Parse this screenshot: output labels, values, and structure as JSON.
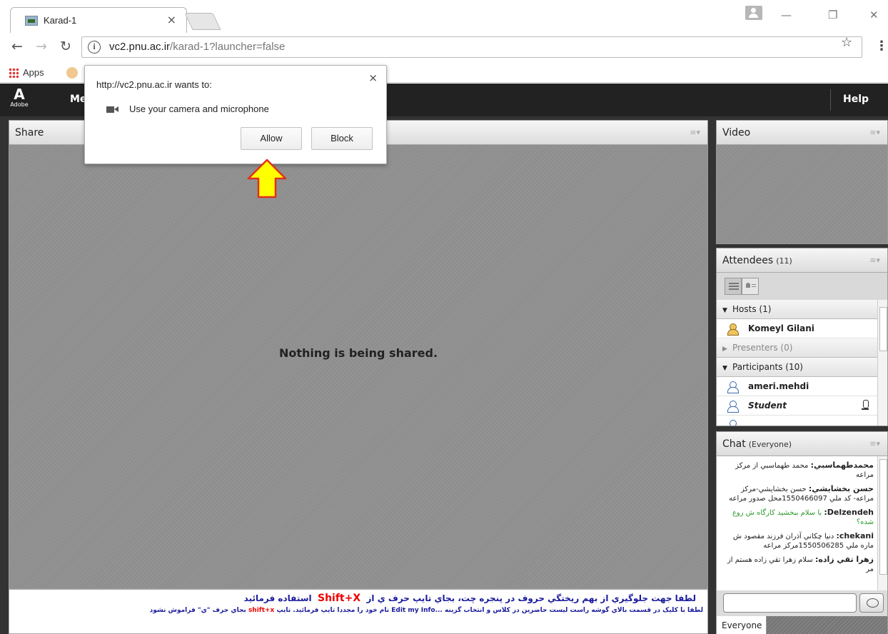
{
  "browser": {
    "tab_title": "Karad-1",
    "tab_close": "×",
    "url_domain": "vc2.pnu.ac.ir",
    "url_rest": "/karad-1?launcher=false",
    "bookmarks_apps": "Apps",
    "window_min": "—",
    "window_max": "❐",
    "window_close": "✕"
  },
  "popup": {
    "title": "http://vc2.pnu.ac.ir wants to:",
    "permission": "Use your camera and microphone",
    "allow": "Allow",
    "block": "Block",
    "close": "×"
  },
  "app": {
    "logo": "Adobe",
    "menu_fragment": "Me",
    "help": "Help"
  },
  "share": {
    "title": "Share",
    "message": "Nothing is being shared."
  },
  "video": {
    "title": "Video"
  },
  "attendees": {
    "title": "Attendees",
    "count": "(11)",
    "groups": {
      "hosts": "Hosts (1)",
      "presenters": "Presenters (0)",
      "participants": "Participants (10)"
    },
    "people": {
      "host1": "Komeyl Gilani",
      "p1": "ameri.mehdi",
      "p2": "Student"
    }
  },
  "chat": {
    "title": "Chat",
    "scope": "(Everyone)",
    "messages": [
      {
        "sender": "محمدطهماسبي:",
        "text": "محمد طهماسبي از مرکز مراعه"
      },
      {
        "sender": "حسن بخشايشي:",
        "text": "حسن بخشايشي-مرکز مراعه- کد ملي 1550466097محل صدور مراعه"
      },
      {
        "sender": "Delzendeh:",
        "text": "با سلام ببخشيد کارگاه ش روع شده؟"
      },
      {
        "sender": "chekani:",
        "text": "دنيا چکاني آذران فرزند مقصود ش ماره ملي 1550506285مرکز مراعه"
      },
      {
        "sender": "زهرا تقي زاده:",
        "text": "سلام زهرا تقي زاده هستم از مر"
      }
    ],
    "tab": "Everyone"
  },
  "notice": {
    "line1_pre": "لطفا جهت جلوگيري از بهم ريختگي حروف در پنجره چت، بجاي تايپ حرف ي از",
    "line1_key": "Shift+X",
    "line1_post": "استفاده فرمائيد",
    "line2_pre": "لطفا با کليک در قسمت بالاي گوشه راست ليست حاضرين در کلاس و انتخاب گزينه ...Edit my Info نام خود را مجددا تايپ فرمائيد. تايپ",
    "line2_key": "shift+x",
    "line2_post": "بجاي حرف \"ي\" فراموش نشود"
  }
}
